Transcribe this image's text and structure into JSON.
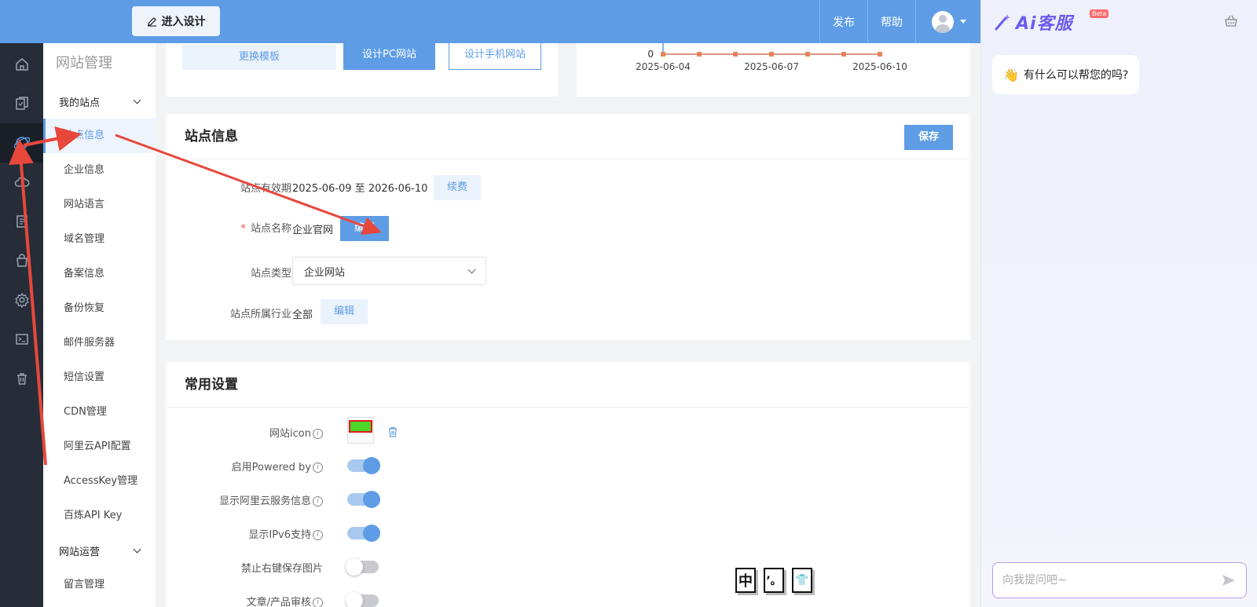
{
  "topbar": {
    "design_button": "进入设计",
    "nav": [
      "发布",
      "帮助"
    ]
  },
  "sidemenu": {
    "title": "网站管理",
    "group_sites": "我的站点",
    "items": [
      "站点信息",
      "企业信息",
      "网站语言",
      "域名管理",
      "备案信息",
      "备份恢复",
      "邮件服务器",
      "短信设置",
      "CDN管理",
      "阿里云API配置",
      "AccessKey管理",
      "百炼API Key"
    ],
    "group_ops": "网站运营",
    "ops_items": [
      "留言管理"
    ]
  },
  "template_card": {
    "change_template": "更换模板",
    "design_pc": "设计PC网站",
    "design_mobile": "设计手机网站"
  },
  "chart_data": {
    "type": "line",
    "x": [
      "2025-06-04",
      "2025-06-05",
      "2025-06-06",
      "2025-06-07",
      "2025-06-08",
      "2025-06-09",
      "2025-06-10"
    ],
    "tick_labels": [
      "2025-06-04",
      "2025-06-07",
      "2025-06-10"
    ],
    "series": [
      {
        "values": [
          0,
          0,
          0,
          0,
          0,
          0,
          0
        ]
      }
    ],
    "y_tick": "0",
    "color": "#e8835e"
  },
  "site_info": {
    "title": "站点信息",
    "save": "保存",
    "validity_label": "站点有效期",
    "validity_value": "2025-06-09 至 2026-06-10",
    "renew": "续费",
    "name_label": "站点名称",
    "name_value": "企业官网",
    "edit": "编辑",
    "type_label": "站点类型",
    "type_value": "企业网站",
    "industry_label": "站点所属行业",
    "industry_value": "全部"
  },
  "common": {
    "title": "常用设置",
    "icon_label": "网站icon",
    "settings": [
      {
        "label": "启用Powered by",
        "info": true,
        "on": true
      },
      {
        "label": "显示阿里云服务信息",
        "info": true,
        "on": true
      },
      {
        "label": "显示IPv6支持",
        "info": true,
        "on": true
      },
      {
        "label": "禁止右键保存图片",
        "info": false,
        "on": false
      },
      {
        "label": "文章/产品审核",
        "info": true,
        "on": false
      }
    ]
  },
  "ai": {
    "brand": "Ai客服",
    "beta": "Beta",
    "greeting": "有什么可以帮您的吗?",
    "input_placeholder": "向我提问吧~"
  },
  "ime": [
    "中",
    "’。",
    "👕"
  ],
  "colors": {
    "primary": "#5e9de6",
    "rail": "#262d38",
    "arrow": "#e8473c"
  }
}
